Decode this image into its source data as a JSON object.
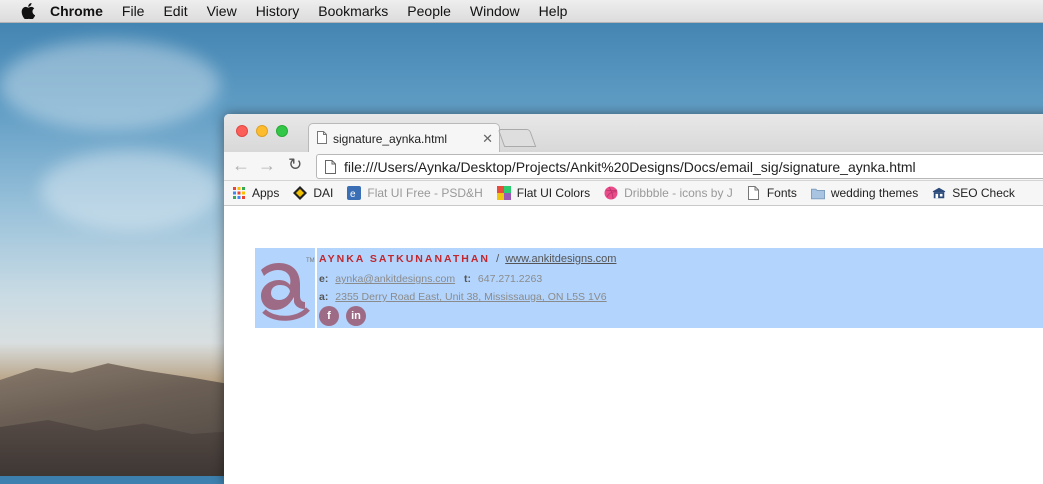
{
  "menubar": {
    "app": "Chrome",
    "items": [
      "File",
      "Edit",
      "View",
      "History",
      "Bookmarks",
      "People",
      "Window",
      "Help"
    ]
  },
  "tab": {
    "title": "signature_aynka.html"
  },
  "toolbar": {
    "url": "file:///Users/Aynka/Desktop/Projects/Ankit%20Designs/Docs/email_sig/signature_aynka.html"
  },
  "bookmarks": [
    {
      "label": "Apps",
      "icon": "apps-grid-icon"
    },
    {
      "label": "DAI",
      "icon": "dai-icon"
    },
    {
      "label": "Flat UI Free - PSD&H",
      "icon": "flat-ui-icon"
    },
    {
      "label": "Flat UI Colors",
      "icon": "flat-ui-colors-icon"
    },
    {
      "label": "Dribbble - icons by J",
      "icon": "dribbble-icon"
    },
    {
      "label": "Fonts",
      "icon": "page-icon"
    },
    {
      "label": "wedding themes",
      "icon": "folder-icon"
    },
    {
      "label": "SEO Check",
      "icon": "seo-icon"
    }
  ],
  "signature": {
    "name": "AYNKA SATKUNANATHAN",
    "separator": "/",
    "website": "www.ankitdesigns.com",
    "email_label": "e:",
    "email": "aynka@ankitdesigns.com",
    "phone_label": "t:",
    "phone": "647.271.2263",
    "address_label": "a:",
    "address": "2355 Derry Road East, Unit 38, Mississauga, ON L5S 1V6",
    "tm": "TM",
    "logo_letter": "a",
    "social": [
      "f",
      "in"
    ]
  },
  "colors": {
    "accent_red": "#c1272d",
    "logo_purple": "#9e6b86",
    "highlight": "#b3d4fc"
  }
}
